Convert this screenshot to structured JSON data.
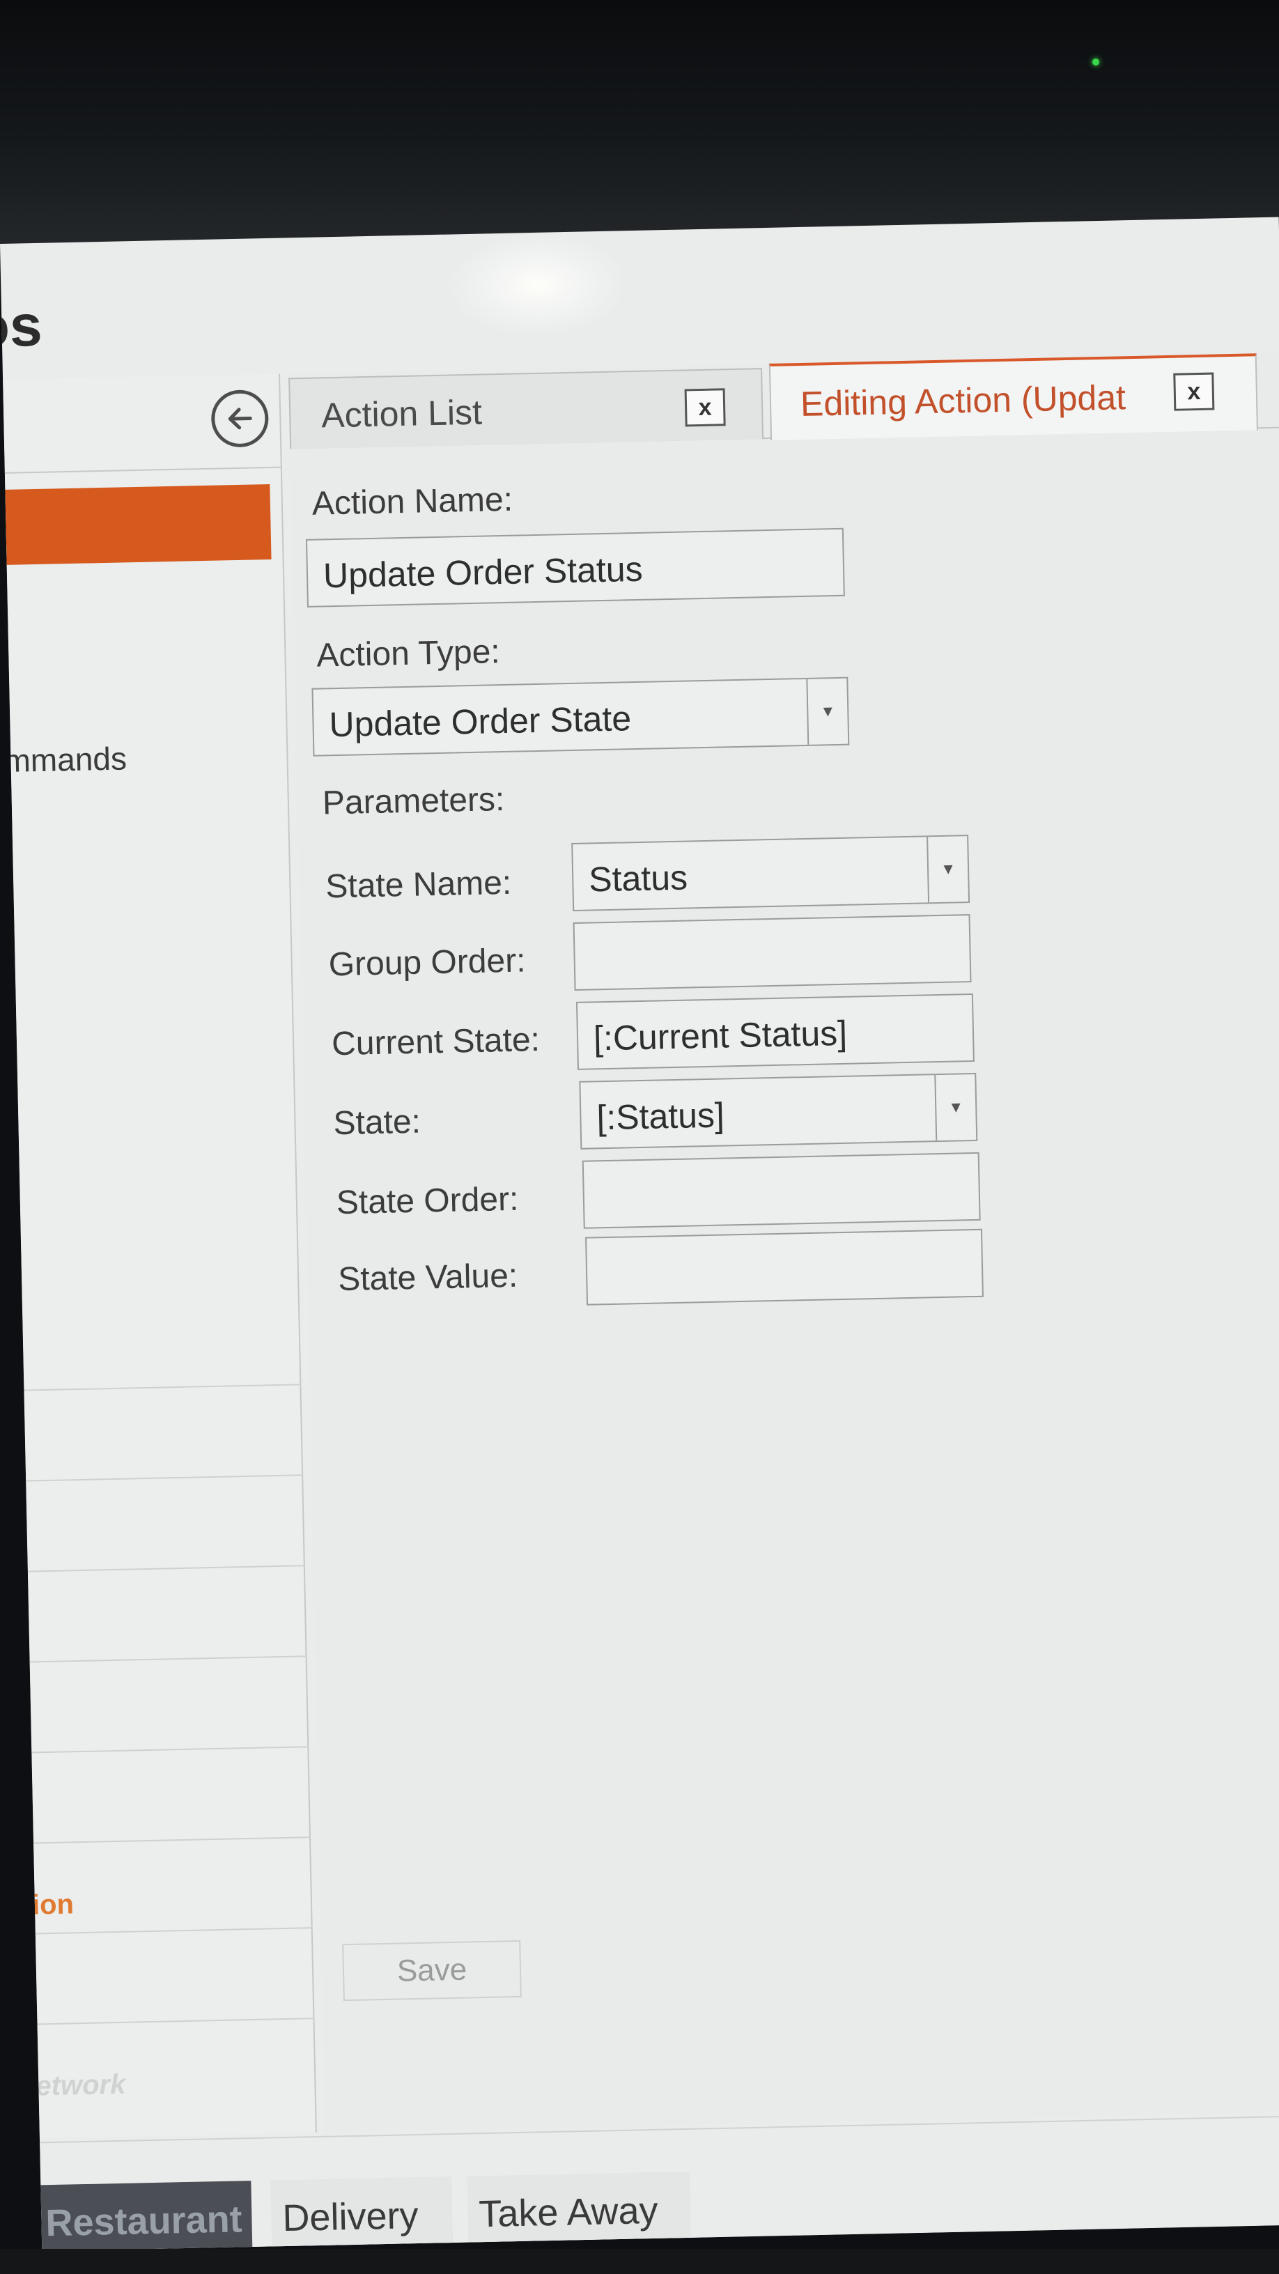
{
  "app": {
    "title_fragment": "os"
  },
  "sidebar": {
    "back_icon": "arrow-left-circle-icon",
    "commands_fragment": "mmands",
    "rows": [
      {
        "label": ""
      },
      {
        "label": ""
      },
      {
        "label": ""
      },
      {
        "label": ""
      },
      {
        "label": ""
      },
      {
        "label": "ion"
      },
      {
        "label": ""
      },
      {
        "label": "etwork"
      }
    ]
  },
  "tabs": [
    {
      "label": "Action List",
      "close_label": "x"
    },
    {
      "label": "Editing Action (Updat",
      "close_label": "x",
      "active": true
    }
  ],
  "form": {
    "action_name_label": "Action Name:",
    "action_name_value": "Update Order Status",
    "action_type_label": "Action Type:",
    "action_type_value": "Update Order State",
    "parameters_label": "Parameters:",
    "params": {
      "state_name": {
        "label": "State Name:",
        "value": "Status"
      },
      "group_order": {
        "label": "Group Order:",
        "value": ""
      },
      "current_state": {
        "label": "Current State:",
        "value": "[:Current Status]"
      },
      "state": {
        "label": "State:",
        "value": "[:Status]"
      },
      "state_order": {
        "label": "State Order:",
        "value": ""
      },
      "state_value": {
        "label": "State Value:",
        "value": ""
      }
    },
    "save_label": "Save"
  },
  "bottom_nav": [
    {
      "label": "Restaurant",
      "active": true
    },
    {
      "label": "Delivery"
    },
    {
      "label": "Take Away"
    }
  ],
  "colors": {
    "accent": "#d65a1e",
    "active_tab_text": "#c2502a",
    "power_led": "#39d84a",
    "active_nav_bg": "#4b4f55"
  }
}
